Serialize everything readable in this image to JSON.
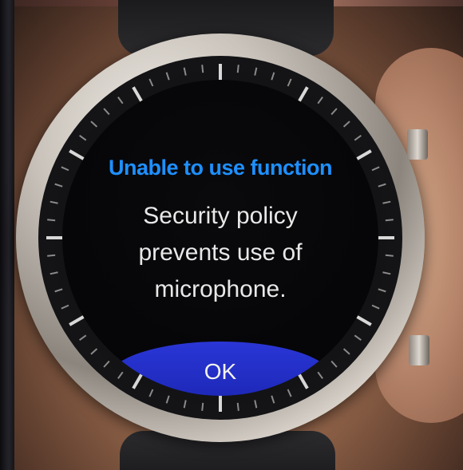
{
  "dialog": {
    "title": "Unable to use function",
    "message_lines": [
      "Security policy",
      "prevents use of",
      "microphone."
    ],
    "ok_label": "OK"
  },
  "colors": {
    "title": "#1e90ff",
    "message": "#e8e8e8",
    "ok_button": "#2a36d6",
    "screen_bg": "#050507"
  },
  "icons": {
    "bezel_ticks": "rotating-bezel-ticks-icon"
  }
}
